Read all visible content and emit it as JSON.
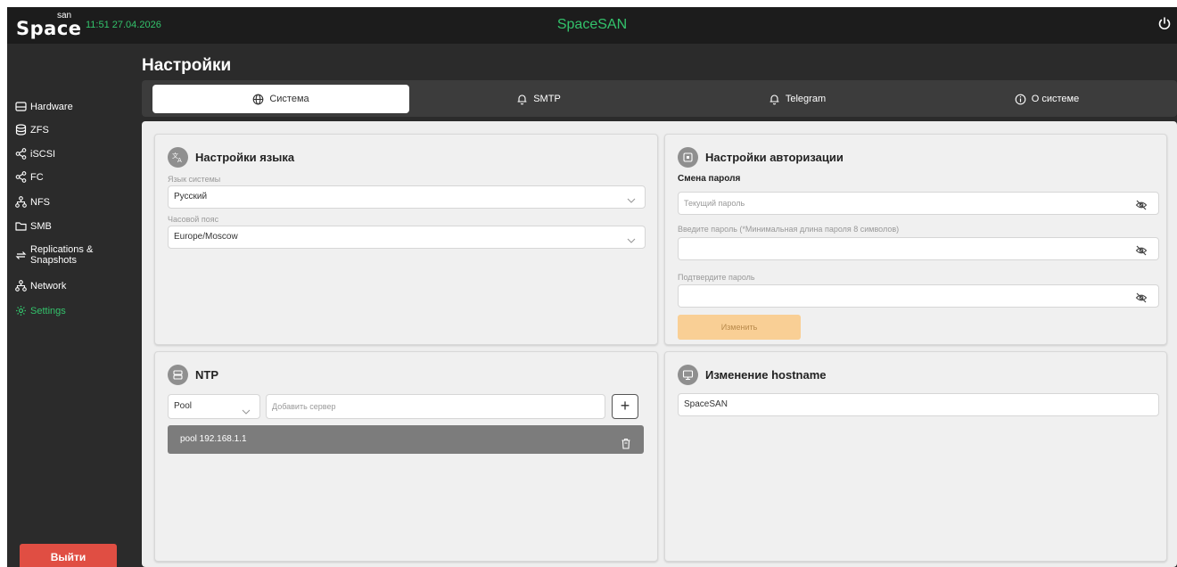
{
  "topbar": {
    "logo_word": "Space",
    "logo_sup": "san",
    "clock": "11:51 27.04.2026",
    "title": "SpaceSAN"
  },
  "sidebar": {
    "items": [
      {
        "label": "Hardware",
        "icon": "hardware-icon"
      },
      {
        "label": "ZFS",
        "icon": "database-icon"
      },
      {
        "label": "iSCSI",
        "icon": "share-icon"
      },
      {
        "label": "FC",
        "icon": "share-icon"
      },
      {
        "label": "NFS",
        "icon": "network-icon"
      },
      {
        "label": "SMB",
        "icon": "folder-icon"
      },
      {
        "label_line1": "Replications &",
        "label_line2": "Snapshots",
        "icon": "replication-icon"
      },
      {
        "label": "Network",
        "icon": "network-icon"
      },
      {
        "label": "Settings",
        "icon": "settings-icon",
        "active": true
      }
    ],
    "logout_label": "Выйти"
  },
  "page_title": "Настройки",
  "tabs": [
    {
      "label": "Система",
      "icon": "globe-icon",
      "active": true
    },
    {
      "label": "SMTP",
      "icon": "bell-icon"
    },
    {
      "label": "Telegram",
      "icon": "bell-icon"
    },
    {
      "label": "О системе",
      "icon": "info-icon"
    }
  ],
  "language_card": {
    "title": "Настройки языка",
    "system_language_label": "Язык системы",
    "system_language_value": "Русский",
    "timezone_label": "Часовой пояс",
    "timezone_value": "Europe/Moscow"
  },
  "auth_card": {
    "title": "Настройки авторизации",
    "subtitle": "Смена пароля",
    "current_password_placeholder": "Текущий пароль",
    "new_password_label": "Введите пароль (*Минимальная длина пароля 8 символов)",
    "confirm_password_label": "Подтвердите пароль",
    "change_button": "Изменить"
  },
  "ntp_card": {
    "title": "NTP",
    "type_value": "Pool",
    "server_placeholder": "Добавить сервер",
    "add_button": "+",
    "servers": [
      {
        "text": "pool  192.168.1.1"
      }
    ]
  },
  "hostname_card": {
    "title": "Изменение hostname",
    "hostname_value": "SpaceSAN"
  },
  "colors": {
    "accent_green": "#33c26b",
    "logout_red": "#e04e43",
    "change_button_bg": "#f9cf95"
  }
}
